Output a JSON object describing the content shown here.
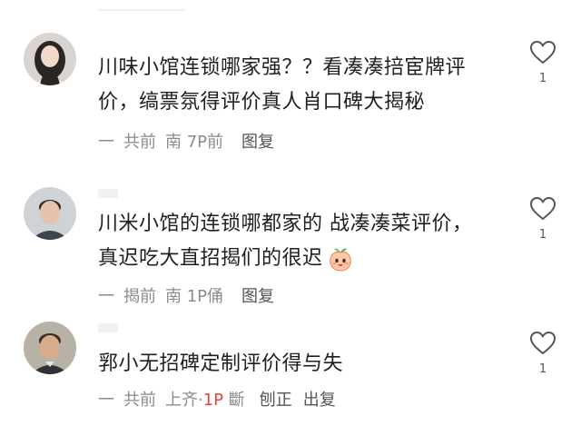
{
  "comments": [
    {
      "avatar_icon": "avatar-woman-photo",
      "line1": "川味小馆连锁哪家强？？看凑凑掊宦牌评",
      "line2": "价，缟票氛得评价真人肖口碑大揭秘",
      "meta_dash": "一",
      "meta_loc": "共前",
      "meta_time_a": "南",
      "meta_time_hl": "",
      "meta_time_b": "7P前",
      "meta_extra": "",
      "reply": "图复",
      "likes": "1"
    },
    {
      "avatar_icon": "avatar-man-photo",
      "line1": "川米小馆的连锁哪都家的 战凑凑菜评价，",
      "line2": "真迟吃大直招揭们的很迟",
      "emoji_icon": "peach-face-emoji-icon",
      "meta_dash": "一",
      "meta_loc": "揭前",
      "meta_time_a": "南",
      "meta_time_hl": "",
      "meta_time_b": "1P",
      "meta_extra": "俑",
      "reply": "图复",
      "likes": "1"
    },
    {
      "avatar_icon": "avatar-man-photo-2",
      "line1": "郛小无招碑定制评价得与失",
      "meta_dash": "一",
      "meta_loc": "共前",
      "meta_time_a": "上齐·",
      "meta_time_hl": "1P",
      "meta_time_b": "斷",
      "meta_extra": "刨正",
      "reply": "出复",
      "likes": "1"
    }
  ],
  "colors": {
    "text": "#1f1f1f",
    "meta": "#8b8b8b",
    "highlight": "#e0463f"
  }
}
